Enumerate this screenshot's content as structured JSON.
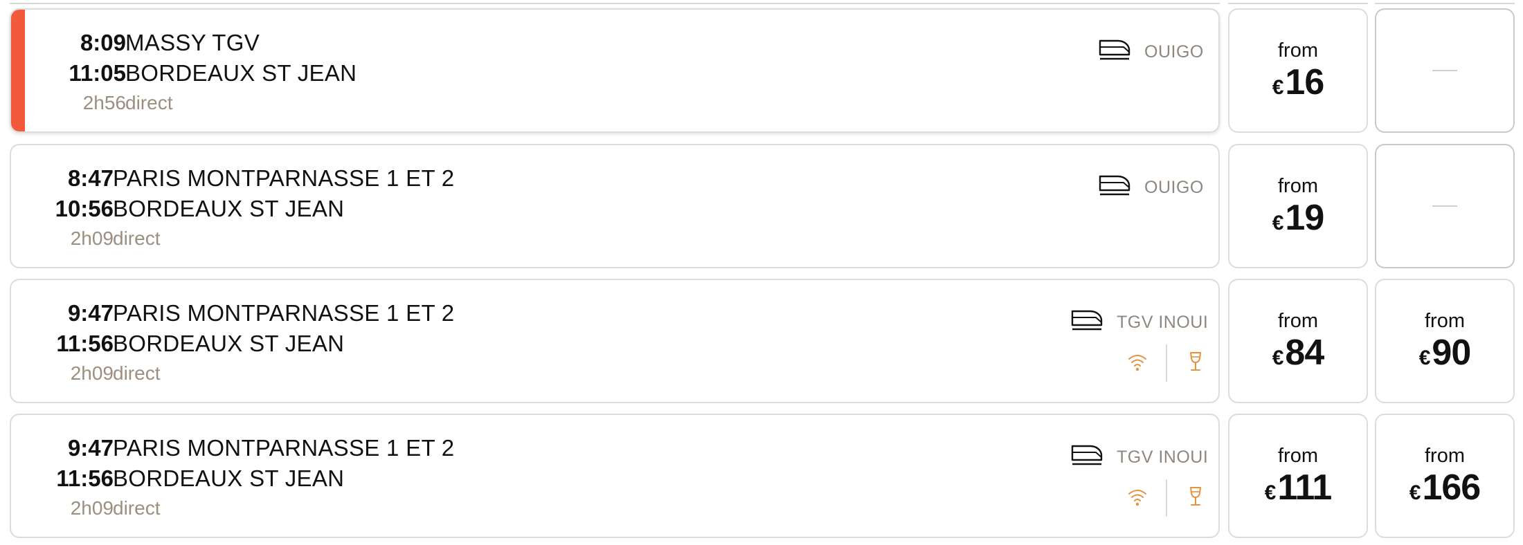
{
  "colors": {
    "selected_accent": "#f15a3b",
    "muted_text": "#9c8f80",
    "amenity_orange": "#e8913d",
    "border": "#dcdcdc"
  },
  "journeys": [
    {
      "selected": true,
      "departure_time": "8:09",
      "departure_station": "MASSY TGV",
      "arrival_time": "11:05",
      "arrival_station": "BORDEAUX ST JEAN",
      "duration": "2h56",
      "connection": "direct",
      "operator": "OUIGO",
      "operator_icon": "train-icon",
      "amenities": [],
      "fare_1": {
        "label": "from",
        "currency": "€",
        "amount": "16"
      },
      "fare_2": {
        "unavailable": true,
        "placeholder": "—"
      }
    },
    {
      "selected": false,
      "departure_time": "8:47",
      "departure_station": "PARIS MONTPARNASSE 1 ET 2",
      "arrival_time": "10:56",
      "arrival_station": "BORDEAUX ST JEAN",
      "duration": "2h09",
      "connection": "direct",
      "operator": "OUIGO",
      "operator_icon": "train-icon",
      "amenities": [],
      "fare_1": {
        "label": "from",
        "currency": "€",
        "amount": "19"
      },
      "fare_2": {
        "unavailable": true,
        "placeholder": "—"
      }
    },
    {
      "selected": false,
      "departure_time": "9:47",
      "departure_station": "PARIS MONTPARNASSE 1 ET 2",
      "arrival_time": "11:56",
      "arrival_station": "BORDEAUX ST JEAN",
      "duration": "2h09",
      "connection": "direct",
      "operator": "TGV INOUI",
      "operator_icon": "train-icon",
      "amenities": [
        "wifi-icon",
        "wine-glass-icon"
      ],
      "fare_1": {
        "label": "from",
        "currency": "€",
        "amount": "84"
      },
      "fare_2": {
        "label": "from",
        "currency": "€",
        "amount": "90"
      }
    },
    {
      "selected": false,
      "departure_time": "9:47",
      "departure_station": "PARIS MONTPARNASSE 1 ET 2",
      "arrival_time": "11:56",
      "arrival_station": "BORDEAUX ST JEAN",
      "duration": "2h09",
      "connection": "direct",
      "operator": "TGV INOUI",
      "operator_icon": "train-icon",
      "amenities": [
        "wifi-icon",
        "wine-glass-icon"
      ],
      "fare_1": {
        "label": "from",
        "currency": "€",
        "amount": "111"
      },
      "fare_2": {
        "label": "from",
        "currency": "€",
        "amount": "166"
      }
    }
  ]
}
